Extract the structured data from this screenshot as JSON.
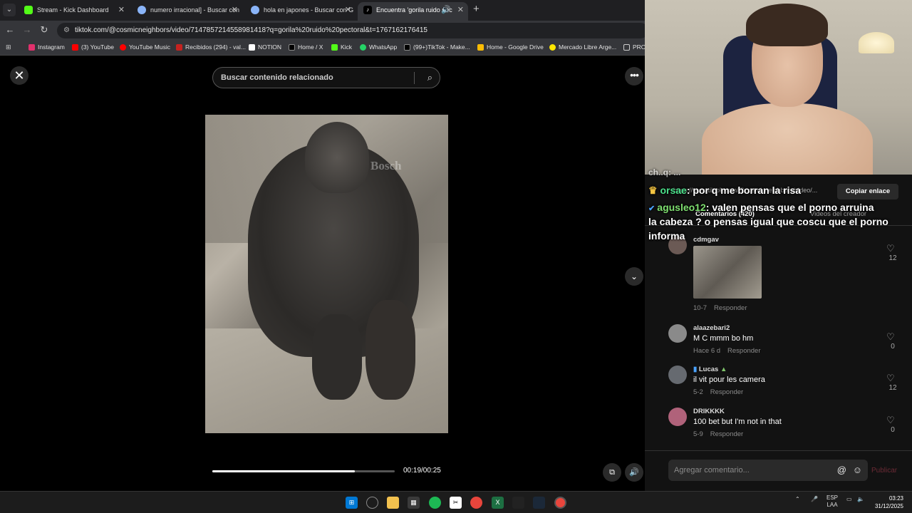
{
  "browser": {
    "tabs": [
      {
        "label": "Stream - Kick Dashboard",
        "color": "#53fc18"
      },
      {
        "label": "numero irracional] - Buscar con",
        "color": "#4285f4"
      },
      {
        "label": "hola en japones - Buscar con G",
        "color": "#4285f4"
      },
      {
        "label": "Encuentra 'gorila ruido pec",
        "color": "#ffffff"
      }
    ],
    "url": "tiktok.com/@cosmicneighbors/video/7147857214558981418?q=gorila%20ruido%20pectoral&t=1767162176415",
    "bookmarks": [
      {
        "label": "Instagram",
        "color": "#e1306c"
      },
      {
        "label": "(3) YouTube",
        "color": "#ff0000"
      },
      {
        "label": "YouTube Music",
        "color": "#ff0000"
      },
      {
        "label": "Recibidos (294) - val...",
        "color": "#c5221f"
      },
      {
        "label": "NOTION",
        "color": "#ffffff"
      },
      {
        "label": "Home / X",
        "color": "#000000"
      },
      {
        "label": "Kick",
        "color": "#53fc18"
      },
      {
        "label": "WhatsApp",
        "color": "#25d366"
      },
      {
        "label": "(99+)TikTok - Make...",
        "color": "#000000"
      },
      {
        "label": "Home - Google Drive",
        "color": "#fbbc04"
      },
      {
        "label": "Mercado Libre Arge...",
        "color": "#ffe600"
      },
      {
        "label": "PRO",
        "color": "#888888"
      }
    ]
  },
  "tiktok": {
    "search_placeholder": "Buscar contenido relacionado",
    "video_watermark": "Bosch",
    "progress": 0.78,
    "time": "00:19/00:25"
  },
  "panel": {
    "url_text": "https://www.tiktok.com/@cosmicneighbors/video/...",
    "copy_link": "Copiar enlace",
    "tab_comments": "Comentarios (420)",
    "tab_creator": "Videos del creador",
    "comments": [
      {
        "user": "cdmgav",
        "text": "",
        "date": "10-7",
        "reply": "Responder",
        "likes": "12",
        "has_image": true,
        "avatar_color": "#6b5a55"
      },
      {
        "user": "alaazebari2",
        "text": "M C mmm bo hm",
        "date": "Hace 6 d",
        "reply": "Responder",
        "likes": "0",
        "has_image": false,
        "avatar_color": "#8a8a8a"
      },
      {
        "user": "Lucas",
        "text": "il vit pour les camera",
        "date": "5-2",
        "reply": "Responder",
        "likes": "12",
        "has_image": false,
        "avatar_color": "#666a70"
      },
      {
        "user": "DRIKKKK",
        "text": "100 bet but I'm not in that",
        "date": "5-9",
        "reply": "Responder",
        "likes": "0",
        "has_image": false,
        "avatar_color": "#b0627a"
      }
    ],
    "add_comment_placeholder": "Agregar comentario...",
    "publish": "Publicar"
  },
  "chat": {
    "line0": "ch..q: ...",
    "line1_nick": "orsae",
    "line1_text": ": por q me borran la risa",
    "line2_nick": "agusleo12",
    "line2_text": ":  valen pensas que el porno arruina",
    "line3": "la cabeza ? o pensas igual que coscu que el porno",
    "line4": "informa"
  },
  "taskbar": {
    "lang": "ESP",
    "lang2": "LAA",
    "time": "03:23",
    "date": "31/12/2025"
  }
}
